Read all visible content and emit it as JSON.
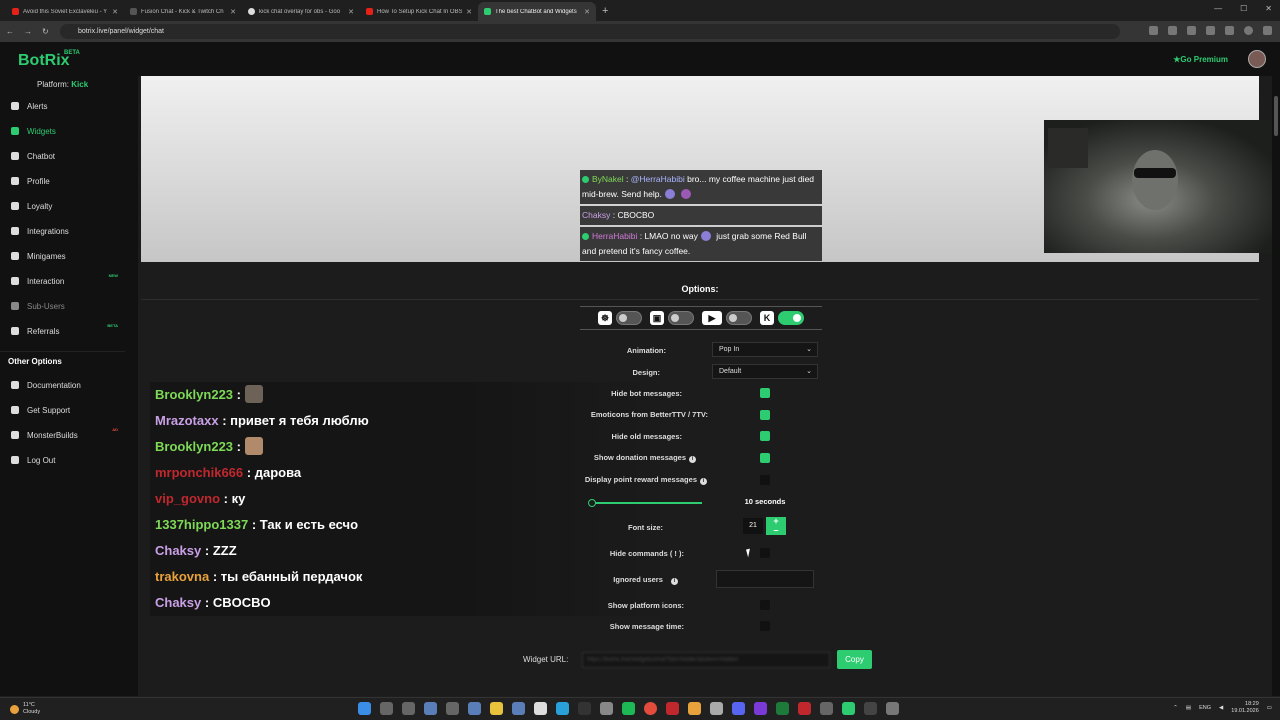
{
  "browser": {
    "tabs": [
      {
        "title": "Avoid this Soviet Exclaveleu - Y",
        "favicon": "youtube-icon",
        "active": false
      },
      {
        "title": "Fusion Chat - Kick & Twitch Ch",
        "favicon": "fusion-icon",
        "active": false
      },
      {
        "title": "kick chat overlay for obs - Goo",
        "favicon": "google-icon",
        "active": false
      },
      {
        "title": "How To Setup Kick Chat In OBS",
        "favicon": "youtube-icon",
        "active": false
      },
      {
        "title": "The best ChatBot and Widgets",
        "favicon": "botrix-icon",
        "active": true
      }
    ],
    "url": "botrix.live/panel/widget/chat"
  },
  "app": {
    "logo": "BotRix",
    "beta": "BETA",
    "platform_label": "Platform:",
    "platform_value": "Kick",
    "premium": "Go Premium"
  },
  "sidebar": {
    "items": [
      {
        "label": "Alerts",
        "icon": "bell-icon"
      },
      {
        "label": "Widgets",
        "icon": "grid-icon",
        "active": true
      },
      {
        "label": "Chatbot",
        "icon": "robot-icon"
      },
      {
        "label": "Profile",
        "icon": "user-icon"
      },
      {
        "label": "Loyalty",
        "icon": "trophy-icon"
      },
      {
        "label": "Integrations",
        "icon": "link-icon"
      },
      {
        "label": "Minigames",
        "icon": "gamepad-icon"
      },
      {
        "label": "Interaction",
        "icon": "music-icon",
        "badge": "NEW"
      },
      {
        "label": "Sub-Users",
        "icon": "users-icon",
        "dim": true
      },
      {
        "label": "Referrals",
        "icon": "referral-icon",
        "badge": "BETA"
      }
    ],
    "other_title": "Other Options",
    "other_items": [
      {
        "label": "Documentation",
        "icon": "doc-icon"
      },
      {
        "label": "Get Support",
        "icon": "question-icon"
      },
      {
        "label": "MonsterBuilds",
        "icon": "monitor-icon",
        "badge": "AD"
      },
      {
        "label": "Log Out",
        "icon": "logout-icon"
      }
    ]
  },
  "preview_chat": [
    {
      "user": "ByNakel",
      "sep": " : ",
      "mention": "@HerraHabibi",
      "text": " bro... my coffee machine just died mid-brew. Send help.",
      "color_class": "u1",
      "kick": true
    },
    {
      "user": "Chaksy",
      "sep": " : ",
      "text": "CBOCBO",
      "color_class": "u3",
      "kick": false
    },
    {
      "user": "HerraHabibi",
      "sep": " : ",
      "text": "LMAO no way",
      "text2": " just grab some Red Bull and pretend it's fancy coffee.",
      "color_class": "u2",
      "kick": true
    }
  ],
  "options": {
    "title": "Options:",
    "platforms": [
      {
        "icon": "botrix-icon",
        "on": false
      },
      {
        "icon": "twitch-icon",
        "on": false
      },
      {
        "icon": "youtube-icon",
        "on": false
      },
      {
        "icon": "kick-icon",
        "on": true
      }
    ],
    "animation_label": "Animation:",
    "animation_value": "Pop In",
    "design_label": "Design:",
    "design_value": "Default",
    "hide_bot_label": "Hide bot messages:",
    "emoticons_label": "Emoticons from BetterTTV / 7TV:",
    "hide_old_label": "Hide old messages:",
    "donation_label": "Show donation messages",
    "point_reward_label": "Display point reward messages",
    "slider_value": "10 seconds",
    "font_size_label": "Font size:",
    "font_size_value": "21",
    "hide_commands_label": "Hide commands ( ! ):",
    "ignored_users_label": "Ignored users",
    "show_platform_label": "Show platform icons:",
    "show_time_label": "Show message time:",
    "widget_url_label": "Widget URL:",
    "widget_url_value": "https://botrix.live/widgets/chat?bid=hidden&token=hidden",
    "copy_label": "Copy"
  },
  "big_chat": [
    {
      "user": "Brooklyn223",
      "sep": " : ",
      "text": "",
      "color": "#7ed957",
      "emote": true
    },
    {
      "user": "Mrazotaxx",
      "sep": " : ",
      "text": "привет я тебя люблю",
      "color": "#c9a0e6"
    },
    {
      "user": "Brooklyn223",
      "sep": " : ",
      "text": "",
      "color": "#7ed957",
      "emote": true
    },
    {
      "user": "mrponchik666",
      "sep": " : ",
      "text": "дарова",
      "color": "#c0282e"
    },
    {
      "user": "vip_govno",
      "sep": " : ",
      "text": "ку",
      "color": "#c0282e"
    },
    {
      "user": "1337hippo1337",
      "sep": " : ",
      "text": "Так и есть есчо",
      "color": "#7ed957"
    },
    {
      "user": "Chaksy",
      "sep": " : ",
      "text": "ZZZ",
      "color": "#c9a0e6"
    },
    {
      "user": "trakovna",
      "sep": " : ",
      "text": "ты ебанный пердачок",
      "color": "#e8a23c"
    },
    {
      "user": "Chaksy",
      "sep": " : ",
      "text": "CBOCBO",
      "color": "#c9a0e6"
    }
  ],
  "taskbar": {
    "temp": "11°C",
    "weather": "Cloudy",
    "lang": "ENG",
    "time": "18:29",
    "date": "19.01.2026"
  }
}
